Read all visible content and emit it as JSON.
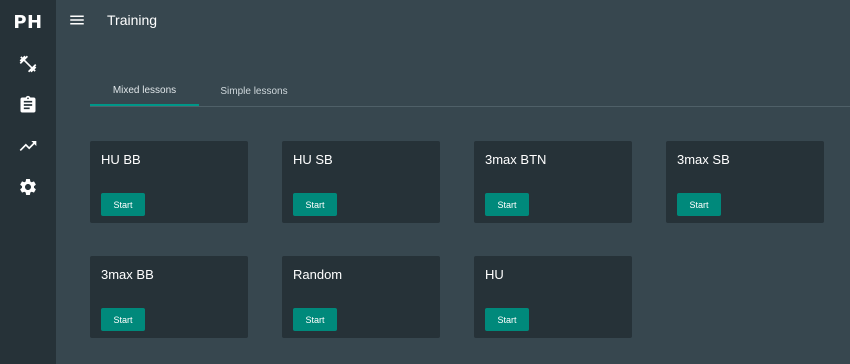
{
  "app": {
    "logo": "PH",
    "title": "Training"
  },
  "sidebar": {
    "items": [
      {
        "icon": "dumbbell-icon"
      },
      {
        "icon": "clipboard-icon"
      },
      {
        "icon": "trending-up-icon"
      },
      {
        "icon": "gear-icon"
      }
    ]
  },
  "tabs": [
    {
      "label": "Mixed lessons",
      "active": true
    },
    {
      "label": "Simple lessons",
      "active": false
    }
  ],
  "lessons": [
    {
      "title": "HU BB",
      "button": "Start"
    },
    {
      "title": "HU SB",
      "button": "Start"
    },
    {
      "title": "3max BTN",
      "button": "Start"
    },
    {
      "title": "3max SB",
      "button": "Start"
    },
    {
      "title": "3max BB",
      "button": "Start"
    },
    {
      "title": "Random",
      "button": "Start"
    },
    {
      "title": "HU",
      "button": "Start"
    }
  ],
  "colors": {
    "background": "#37474f",
    "sidebar": "#263238",
    "card": "#263238",
    "accent": "#009688",
    "button": "#00897b"
  }
}
